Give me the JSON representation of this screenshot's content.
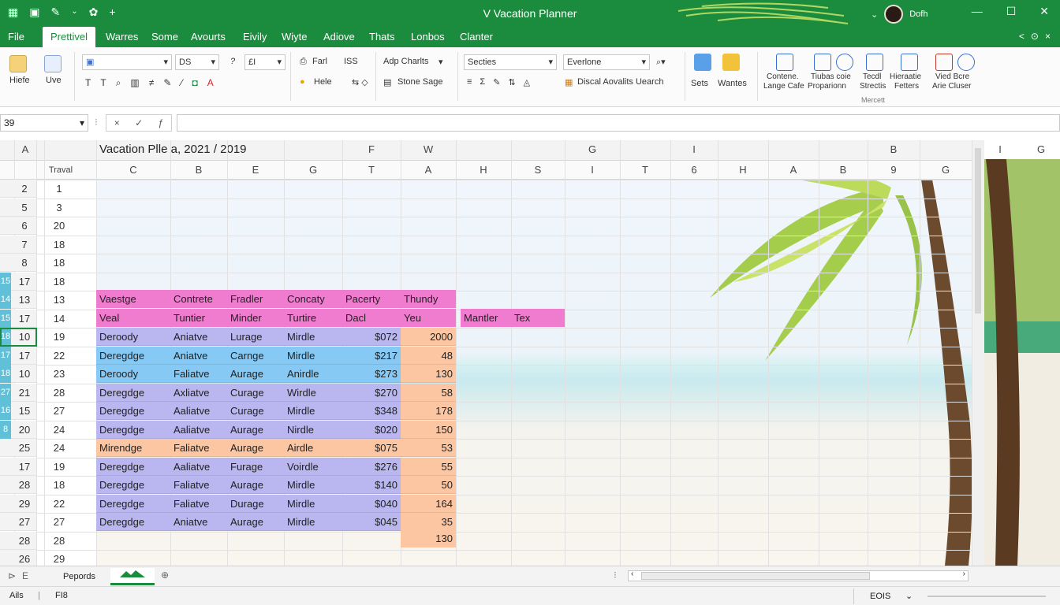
{
  "colors": {
    "accent": "#1b8c3d",
    "pink": "#f07ccf",
    "blue": "#86c9f5",
    "lavender": "#b9b6f0",
    "peach": "#fcc6a2"
  },
  "titlebar": {
    "title": "V Vacation Planner",
    "user": "Dofh",
    "qa_icons": [
      "grid-icon",
      "save-icon",
      "pen-icon",
      "chevron-down-icon",
      "palette-icon",
      "plus-icon"
    ]
  },
  "menu": {
    "tabs": [
      "File",
      "Prettivel",
      "Warres",
      "Some",
      "Avourts",
      "Eivily",
      "Wiyte",
      "Adiove",
      "Thats",
      "Lonbos",
      "Clanter"
    ],
    "right": [
      "<",
      "⊙",
      "×"
    ]
  },
  "ribbon": {
    "paste": "Hiefe",
    "live": "Uve",
    "font_name": "",
    "font_size": "DS",
    "style_num": "£I",
    "fart": "Farl",
    "iss": "ISS",
    "hele": "Hele",
    "add_charts": "Adp Charlts",
    "stone_sage": "Stone Sage",
    "secties": "Secties",
    "evertone": "Everlone",
    "discal": "Discal Aovalits Uearch",
    "sets": "Sets",
    "wantes": "Wantes",
    "contene": "Contene.",
    "lange_cafe": "Lange Cafe",
    "tiubas": "Tiubas coie",
    "proparionn": "Proparionn",
    "tecdl": "Tecdl",
    "strectis": "Strectis",
    "hieratie": "Hieraatie",
    "fetters": "Fetters",
    "vied": "Vied Bcre",
    "arie_claser": "Arie Cluser",
    "group_label": "Mercett"
  },
  "formula": {
    "namebox": "39",
    "fx_icons": [
      "×",
      "✓",
      "ƒ"
    ]
  },
  "grid": {
    "col_headers_top": [
      "A",
      "",
      "Vacation Plle a, 2021 / 2019",
      "F",
      "W",
      "G",
      "I",
      "B",
      "I",
      "G"
    ],
    "sheet_title": "Vacation Plle a, 2021 / 2019",
    "col_headers_row2": [
      "Traval",
      "C",
      "B",
      "E",
      "G",
      "T",
      "A",
      "H",
      "S",
      "I",
      "T",
      "6",
      "H",
      "A",
      "B",
      "9",
      "G"
    ],
    "left_numbers": [
      "2",
      "5",
      "6",
      "7",
      "8",
      "17",
      "13",
      "17",
      "10",
      "17",
      "10",
      "21",
      "15",
      "20",
      "25",
      "17",
      "28",
      "29",
      "27",
      "28",
      "26"
    ],
    "left_strip": [
      "",
      "",
      "",
      "",
      "",
      "15",
      "14",
      "15",
      "18",
      "17",
      "18",
      "27",
      "16",
      "8",
      "",
      "",
      "",
      "",
      "",
      "",
      ""
    ],
    "second_numbers": [
      "1",
      "3",
      "20",
      "18",
      "18",
      "18",
      "13",
      "14",
      "19",
      "22",
      "23",
      "28",
      "27",
      "24",
      "24",
      "19",
      "18",
      "22",
      "27",
      "28",
      "29"
    ],
    "header_row1": [
      "Vaestge",
      "Contrete",
      "Fradler",
      "Concaty",
      "Pacerty",
      "Thundy"
    ],
    "header_row2": [
      "Veal",
      "Tuntier",
      "Minder",
      "Turtire",
      "Dacl",
      "Yeu"
    ],
    "extra_headers": [
      "Mantler",
      "Tex"
    ],
    "rows": [
      {
        "c": [
          "Deroody",
          "Aniatve",
          "Lurage",
          "Mirdle",
          "$072",
          "2000"
        ],
        "band": "lav"
      },
      {
        "c": [
          "Deregdge",
          "Aniatve",
          "Carnge",
          "Mirdle",
          "$217",
          "48"
        ],
        "band": "blue"
      },
      {
        "c": [
          "Deroody",
          "Faliatve",
          "Aurage",
          "Anirdle",
          "$273",
          "130"
        ],
        "band": "blue"
      },
      {
        "c": [
          "Deregdge",
          "Axliatve",
          "Curage",
          "Wirdle",
          "$270",
          "58"
        ],
        "band": "lav"
      },
      {
        "c": [
          "Deregdge",
          "Aaliatve",
          "Curage",
          "Mirdle",
          "$348",
          "178"
        ],
        "band": "lav"
      },
      {
        "c": [
          "Deregdge",
          "Aaliatve",
          "Aurage",
          "Nirdle",
          "$020",
          "150"
        ],
        "band": "lav"
      },
      {
        "c": [
          "Mirendge",
          "Faliatve",
          "Aurage",
          "Airdle",
          "$075",
          "53"
        ],
        "band": "peach"
      },
      {
        "c": [
          "Deregdge",
          "Aaliatve",
          "Furage",
          "Voirdle",
          "$276",
          "55"
        ],
        "band": "lav"
      },
      {
        "c": [
          "Deregdge",
          "Faliatve",
          "Aurage",
          "Mirdle",
          "$140",
          "50"
        ],
        "band": "lav"
      },
      {
        "c": [
          "Deregdge",
          "Faliatve",
          "Durage",
          "Mirdle",
          "$040",
          "164"
        ],
        "band": "lav"
      },
      {
        "c": [
          "Deregdge",
          "Aniatve",
          "Aurage",
          "Mirdle",
          "$045",
          "35"
        ],
        "band": "lav"
      }
    ],
    "last_value": "130"
  },
  "sheet_tabs": {
    "tab1": "Pepords",
    "tab_icons": [
      "first-sheet-icon",
      "prev-sheet-icon",
      "palm-sheet-icon",
      "add-sheet-icon"
    ]
  },
  "status": {
    "left1": "Ails",
    "left2": "FI8",
    "right": "EOIS"
  }
}
